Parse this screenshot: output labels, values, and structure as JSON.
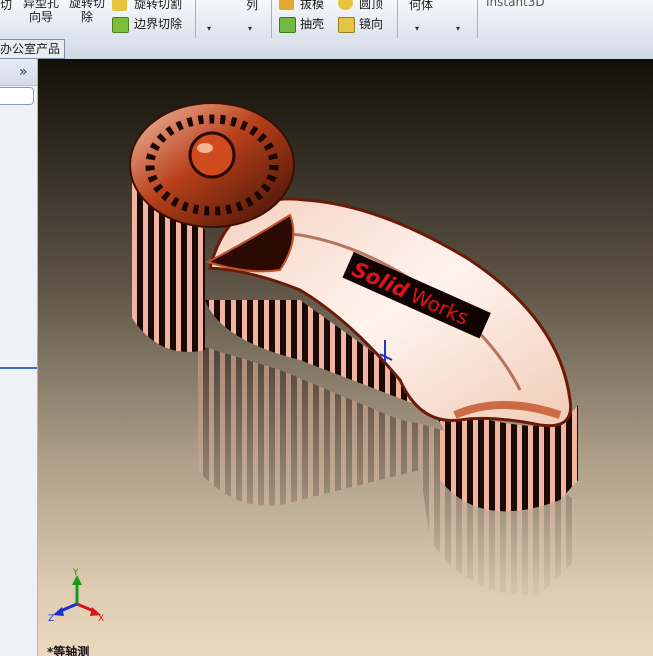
{
  "ribbon": {
    "cut_label": "切",
    "hole_wizard_label": "异型孔\n向导",
    "revolve_cut_label": "旋转切\n除",
    "swept_cut_label": "旋转切割",
    "boundary_cut_label": "边界切除",
    "pattern_label": "列",
    "draft_label": "拔模",
    "shell_label": "抽壳",
    "dome_label": "圆顶",
    "mirror_label": "镜向",
    "geometry_label": "何体",
    "instant3d_label": "Instant3D"
  },
  "tabs": {
    "office_products": "办公室产品"
  },
  "viewport": {
    "view_name": "*等轴测",
    "triad": {
      "x": "X",
      "y": "Y",
      "z": "Z"
    },
    "model_text": {
      "solid": "Solid",
      "works": "Works"
    }
  },
  "colors": {
    "viewport_top": "#121008",
    "viewport_bottom": "#ead8bf",
    "copper": "#c24a1e",
    "logo_red": "#d9141b"
  },
  "icons": {
    "zoom_fit": "magnifier-icon",
    "zoom_area": "zoom-area-icon",
    "previous_view": "previous-view-icon",
    "section_view": "section-view-icon",
    "view_orientation": "cube-orientation-icon",
    "display_style": "display-style-icon",
    "hide_show": "eye-icon",
    "appearance": "appearance-sphere-icon",
    "scene": "scene-monitor-icon",
    "expand": "double-chevron-right-icon"
  }
}
